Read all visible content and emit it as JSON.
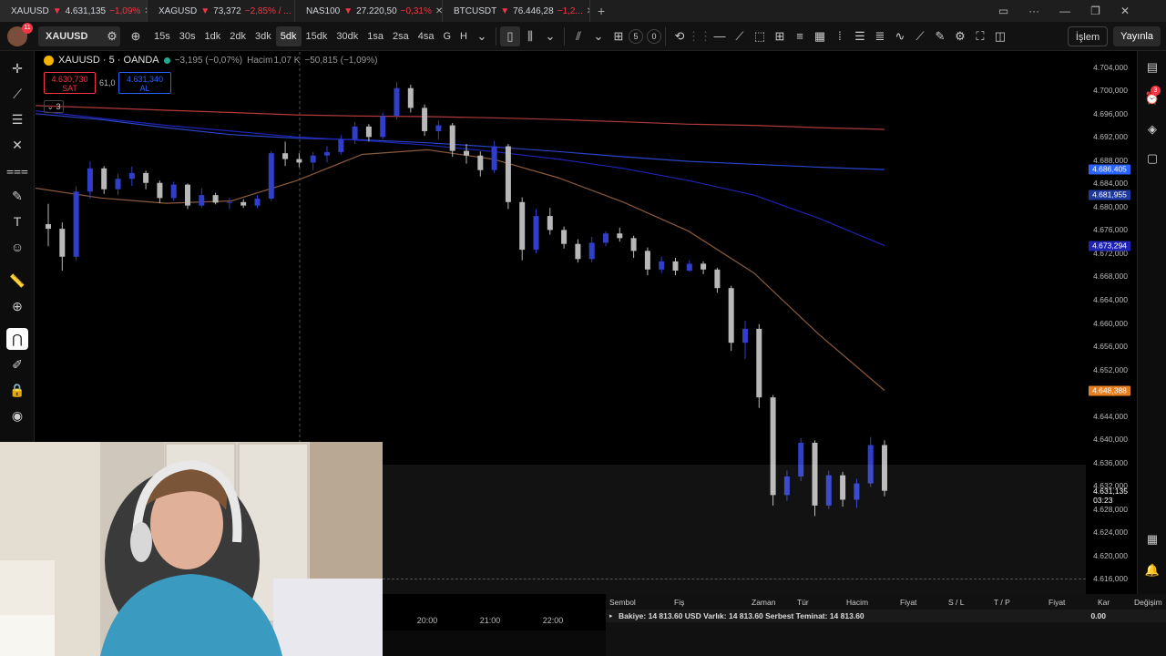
{
  "tabs": [
    {
      "symbol": "XAUUSD",
      "price": "4.631,135",
      "change": "−1,09%",
      "color": "#f5b400"
    },
    {
      "symbol": "XAGUSD",
      "price": "73,372",
      "change": "−2,85% / ...",
      "color": "#9aa0a6"
    },
    {
      "symbol": "NAS100",
      "price": "27.220,50",
      "change": "−0,31%",
      "color": "#2196f3"
    },
    {
      "symbol": "BTCUSDT",
      "price": "76.446,28",
      "change": "−1,2...",
      "color": "#f7931a"
    }
  ],
  "toolbar": {
    "notifications": "11",
    "symbol": "XAUUSD",
    "intervals": [
      "15s",
      "30s",
      "1dk",
      "2dk",
      "3dk",
      "5dk",
      "15dk",
      "30dk",
      "1sa",
      "2sa",
      "4sa",
      "G",
      "H"
    ],
    "active_interval": "5dk",
    "counter_a": "5",
    "counter_b": "0",
    "islem_label": "İşlem",
    "publish_label": "Yayınla"
  },
  "legend": {
    "title": "XAUUSD · 5 · OANDA",
    "change": "−3,195 (−0,07%)",
    "volume_label": "Hacim",
    "volume_value": "1,07 K",
    "volume_change": "−50,815 (−1,09%)",
    "sell_price": "4.630,730",
    "sell_label": "SAT",
    "spread": "61,0",
    "buy_price": "4.631,340",
    "buy_label": "AL",
    "collapsed_count": "3"
  },
  "right_badge": "3",
  "y_axis": {
    "ticks": [
      "4.704,000",
      "4.700,000",
      "4.696,000",
      "4.692,000",
      "4.688,000",
      "4.684,000",
      "4.680,000",
      "4.676,000",
      "4.672,000",
      "4.668,000",
      "4.664,000",
      "4.660,000",
      "4.656,000",
      "4.652,000",
      "4.648,000",
      "4.644,000",
      "4.640,000",
      "4.636,000",
      "4.632,000",
      "4.628,000",
      "4.624,000",
      "4.620,000",
      "4.616,000"
    ],
    "tags": [
      {
        "value": "4.686,405",
        "color": "#2962ff"
      },
      {
        "value": "4.681,955",
        "color": "#1e3a9e"
      },
      {
        "value": "4.673,294",
        "color": "#1f23b3"
      },
      {
        "value": "4.648,388",
        "color": "#e67e22"
      }
    ],
    "current_price": "4.631,135",
    "countdown": "03:23"
  },
  "x_axis": {
    "labels": [
      "20:00",
      "21:00",
      "22:00"
    ]
  },
  "positions_panel": {
    "headers": [
      "Sembol",
      "Fiş",
      "Zaman",
      "Tür",
      "Hacim",
      "Fiyat",
      "S / L",
      "T / P",
      "Fiyat",
      "Kar",
      "Değişim"
    ],
    "summary": "Bakiye: 14 813.60 USD  Varlık: 14 813.60  Serbest Teminat: 14 813.60",
    "profit": "0.00"
  },
  "chart_data": {
    "type": "candlestick",
    "symbol": "XAUUSD",
    "interval": "5dk",
    "ylim": [
      4614,
      4706
    ],
    "x_labels": [
      "20:00",
      "21:00",
      "22:00"
    ],
    "ma_lines": [
      {
        "color": "#b03a3a",
        "values": [
          4697.4,
          4697.0,
          4696.6,
          4696.2,
          4695.8,
          4695.6,
          4695.5,
          4695.3,
          4695.0,
          4694.6,
          4694.2,
          4694.0,
          4693.6,
          4693.3
        ]
      },
      {
        "color": "#2944c9",
        "values": [
          4696.0,
          4695.0,
          4693.6,
          4692.4,
          4691.8,
          4691.5,
          4691.0,
          4690.3,
          4689.5,
          4688.6,
          4687.8,
          4687.3,
          4686.8,
          4686.4
        ]
      },
      {
        "color": "#1f23b3",
        "values": [
          4696.5,
          4695.2,
          4694.0,
          4693.0,
          4692.0,
          4691.4,
          4690.6,
          4689.5,
          4688.2,
          4686.6,
          4684.5,
          4682.0,
          4678.0,
          4673.3
        ]
      },
      {
        "color": "#8a5a3a",
        "values": [
          4683.2,
          4681.5,
          4680.6,
          4681.0,
          4684.5,
          4689.0,
          4689.8,
          4688.2,
          4685.0,
          4680.8,
          4675.8,
          4668.6,
          4658.0,
          4648.4
        ]
      }
    ],
    "candles": [
      [
        4677.0,
        4680.5,
        4673.2,
        4676.2
      ],
      [
        4676.2,
        4677.3,
        4669.0,
        4671.4
      ],
      [
        4671.4,
        4683.5,
        4670.8,
        4682.6
      ],
      [
        4682.6,
        4687.8,
        4681.4,
        4686.6
      ],
      [
        4686.6,
        4687.0,
        4682.2,
        4683.0
      ],
      [
        4683.0,
        4685.6,
        4682.0,
        4684.8
      ],
      [
        4684.8,
        4686.9,
        4683.6,
        4685.8
      ],
      [
        4685.8,
        4686.2,
        4683.0,
        4684.1
      ],
      [
        4684.1,
        4684.5,
        4680.6,
        4681.5
      ],
      [
        4681.5,
        4684.3,
        4681.0,
        4683.8
      ],
      [
        4683.8,
        4684.0,
        4679.6,
        4680.2
      ],
      [
        4680.2,
        4683.2,
        4679.8,
        4682.0
      ],
      [
        4682.0,
        4682.4,
        4680.4,
        4680.7
      ],
      [
        4680.7,
        4681.5,
        4679.6,
        4680.8
      ],
      [
        4680.8,
        4681.3,
        4679.8,
        4680.2
      ],
      [
        4680.2,
        4682.0,
        4679.7,
        4681.4
      ],
      [
        4681.4,
        4689.6,
        4681.0,
        4689.2
      ],
      [
        4689.2,
        4691.2,
        4687.0,
        4688.2
      ],
      [
        4688.2,
        4689.2,
        4686.8,
        4687.6
      ],
      [
        4687.6,
        4689.4,
        4686.3,
        4688.8
      ],
      [
        4688.8,
        4690.4,
        4687.6,
        4689.4
      ],
      [
        4689.4,
        4692.3,
        4689.0,
        4691.6
      ],
      [
        4691.6,
        4694.6,
        4690.8,
        4693.8
      ],
      [
        4693.8,
        4694.2,
        4691.2,
        4692.0
      ],
      [
        4692.0,
        4696.2,
        4691.6,
        4695.6
      ],
      [
        4695.6,
        4701.4,
        4695.0,
        4700.4
      ],
      [
        4700.4,
        4701.0,
        4696.2,
        4697.0
      ],
      [
        4697.0,
        4697.6,
        4692.2,
        4693.0
      ],
      [
        4693.0,
        4694.8,
        4691.6,
        4694.0
      ],
      [
        4694.0,
        4694.4,
        4688.6,
        4689.6
      ],
      [
        4689.6,
        4690.8,
        4687.4,
        4688.8
      ],
      [
        4688.8,
        4689.5,
        4685.2,
        4686.3
      ],
      [
        4686.3,
        4691.3,
        4685.8,
        4690.4
      ],
      [
        4690.4,
        4690.8,
        4679.6,
        4680.8
      ],
      [
        4680.8,
        4681.6,
        4670.8,
        4672.6
      ],
      [
        4672.6,
        4679.6,
        4672.0,
        4678.4
      ],
      [
        4678.4,
        4679.8,
        4675.2,
        4676.0
      ],
      [
        4676.0,
        4676.6,
        4672.8,
        4673.6
      ],
      [
        4673.6,
        4674.4,
        4670.4,
        4671.0
      ],
      [
        4671.0,
        4674.8,
        4670.4,
        4673.8
      ],
      [
        4673.8,
        4675.8,
        4673.2,
        4675.4
      ],
      [
        4675.4,
        4676.4,
        4674.0,
        4674.6
      ],
      [
        4674.6,
        4675.0,
        4671.2,
        4672.4
      ],
      [
        4672.4,
        4673.0,
        4668.2,
        4669.2
      ],
      [
        4669.2,
        4671.4,
        4668.6,
        4670.6
      ],
      [
        4670.6,
        4671.2,
        4668.2,
        4669.0
      ],
      [
        4669.0,
        4670.8,
        4668.8,
        4670.2
      ],
      [
        4670.2,
        4670.6,
        4668.4,
        4669.2
      ],
      [
        4669.2,
        4669.5,
        4665.2,
        4666.0
      ],
      [
        4666.0,
        4666.4,
        4655.2,
        4656.6
      ],
      [
        4656.6,
        4660.4,
        4653.8,
        4659.0
      ],
      [
        4659.0,
        4659.8,
        4645.4,
        4647.2
      ],
      [
        4647.2,
        4647.6,
        4628.6,
        4630.4
      ],
      [
        4630.4,
        4634.6,
        4629.4,
        4633.6
      ],
      [
        4633.6,
        4640.2,
        4632.8,
        4639.4
      ],
      [
        4639.4,
        4639.8,
        4626.8,
        4628.6
      ],
      [
        4628.6,
        4634.6,
        4628.0,
        4633.8
      ],
      [
        4633.8,
        4634.4,
        4628.4,
        4629.6
      ],
      [
        4629.6,
        4633.2,
        4628.2,
        4632.4
      ],
      [
        4632.4,
        4640.4,
        4631.8,
        4639.0
      ],
      [
        4639.0,
        4639.8,
        4630.2,
        4631.135
      ]
    ]
  }
}
